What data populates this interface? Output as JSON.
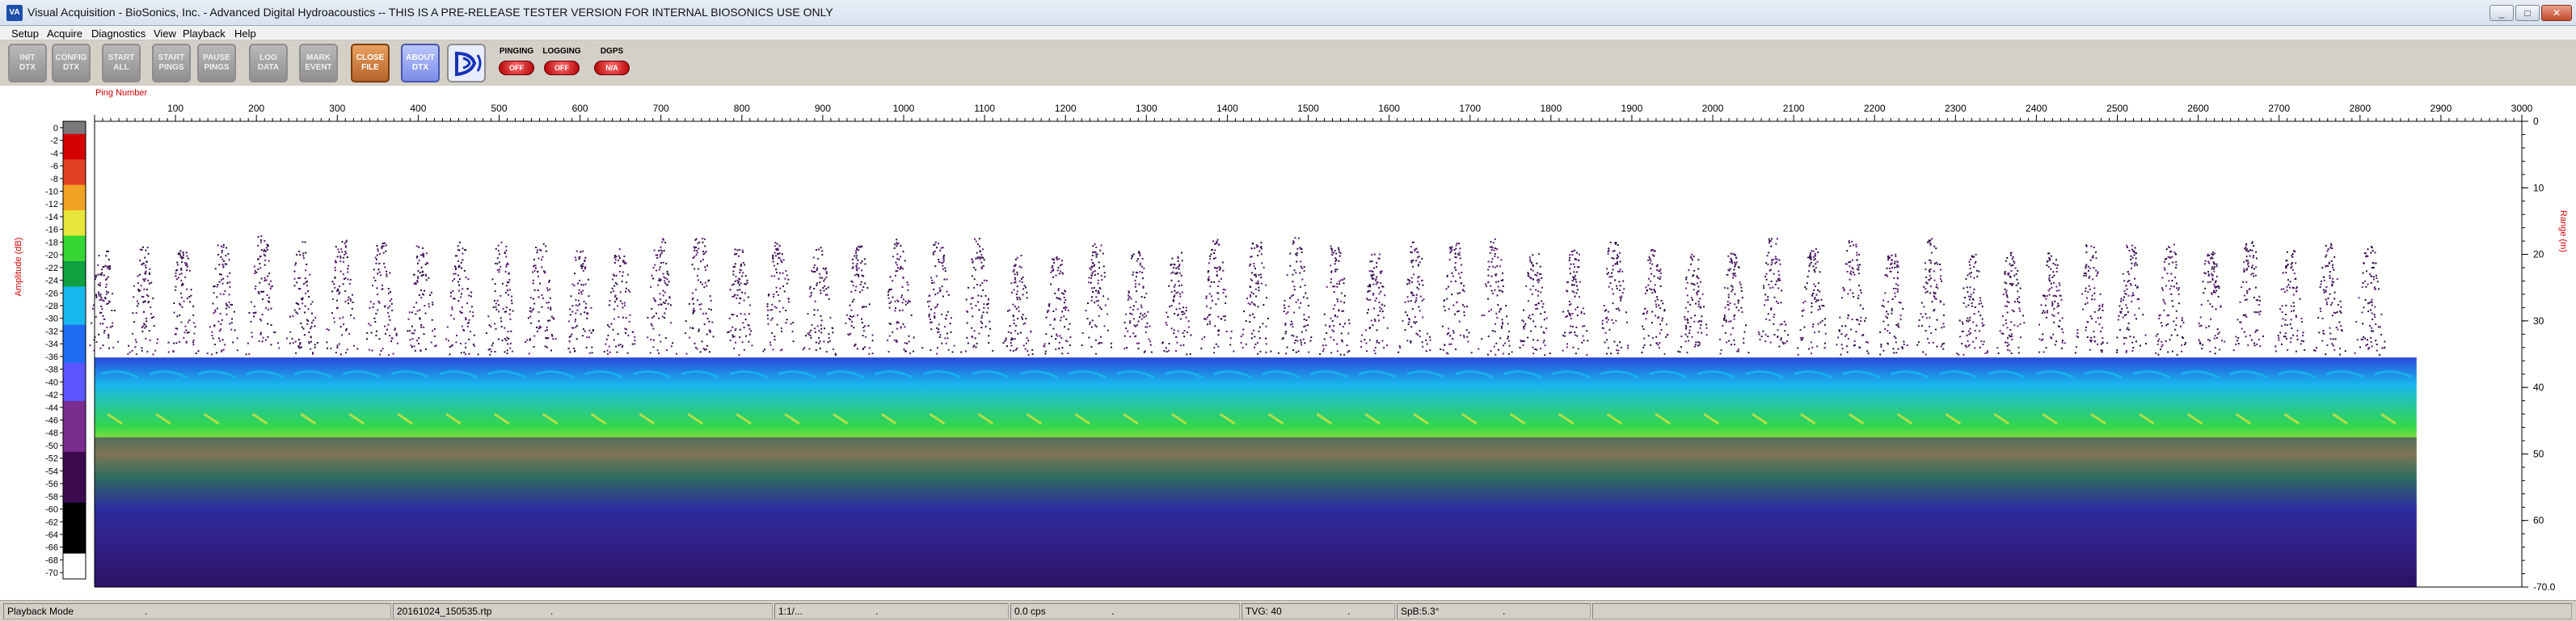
{
  "window": {
    "icon_text": "VA",
    "title": "Visual Acquisition  - BioSonics, Inc.  - Advanced Digital Hydroacoustics  -- THIS IS A PRE-RELEASE TESTER VERSION FOR INTERNAL BIOSONICS USE ONLY",
    "min": "_",
    "max": "□",
    "close": "✕"
  },
  "menu": [
    "Setup",
    "Acquire",
    "Diagnostics",
    "View",
    "Playback",
    "Help"
  ],
  "toolbar": {
    "buttons": [
      {
        "label": "INIT\nDTX",
        "style": "gray"
      },
      {
        "label": "CONFIG\nDTX",
        "style": "gray"
      },
      {
        "label": "START\nALL",
        "style": "gray"
      },
      {
        "label": "START\nPINGS",
        "style": "gray"
      },
      {
        "label": "PAUSE\nPINGS",
        "style": "gray"
      },
      {
        "label": "LOG\nDATA",
        "style": "gray"
      },
      {
        "label": "MARK\nEVENT",
        "style": "gray"
      },
      {
        "label": "CLOSE\nFILE",
        "style": "orange"
      },
      {
        "label": "ABOUT\nDTX",
        "style": "blue"
      }
    ],
    "logo_icon": "biosonics-logo-icon",
    "indicators": [
      {
        "label": "PINGING",
        "state": "OFF"
      },
      {
        "label": "LOGGING",
        "state": "OFF"
      },
      {
        "label": "DGPS",
        "state": "N/A"
      }
    ]
  },
  "colors": {
    "echo_weak": "#5b1a73",
    "echo_blue": "#2a49d8",
    "echo_green": "#33d64a",
    "echo_yellow": "#e8e43a",
    "echo_red": "#e22a1a",
    "axis_label_red": "#d40000"
  },
  "echogram": {
    "x_axis_label": "Ping Number",
    "x_ticks": [
      100,
      200,
      300,
      400,
      500,
      600,
      700,
      800,
      900,
      1000,
      1100,
      1200,
      1300,
      1400,
      1500,
      1600,
      1700,
      1800,
      1900,
      2000,
      2100,
      2200,
      2300,
      2400,
      2500,
      2600,
      2700,
      2800,
      2900,
      3000
    ],
    "x_range": [
      0,
      3000
    ],
    "pings_recorded": 2870,
    "range_label": "Range (m)",
    "range_ticks": [
      "0",
      "10",
      "20",
      "30",
      "40",
      "50",
      "60",
      "-70.0"
    ],
    "range_max": 70,
    "amplitude_label": "Amplitude (dB)",
    "amplitude_ticks": [
      0,
      -2,
      -4,
      -6,
      -8,
      -10,
      -12,
      -14,
      -16,
      -18,
      -20,
      -22,
      -24,
      -26,
      -28,
      -30,
      -32,
      -34,
      -36,
      -38,
      -40,
      -42,
      -44,
      -46,
      -48,
      -50,
      -52,
      -54,
      -56,
      -58,
      -60,
      -62,
      -64,
      -66,
      -68,
      -70
    ],
    "amplitude_range": [
      0,
      -70
    ],
    "color_scale": [
      "#ffffff",
      "#000000",
      "#3b0a4f",
      "#7a2d8f",
      "#5a55ff",
      "#1f6cf0",
      "#18b8ee",
      "#10a040",
      "#36d633",
      "#e6e63a",
      "#f2a223",
      "#e04020",
      "#d40000",
      "#7a7a7a"
    ]
  },
  "status": [
    {
      "text": "Playback Mode",
      "dot": "."
    },
    {
      "text": "20161024_150535.rtp",
      "dot": "."
    },
    {
      "text": "1:1/...",
      "dot": "."
    },
    {
      "text": "0.0 cps",
      "dot": "."
    },
    {
      "text": "TVG: 40",
      "dot": "."
    },
    {
      "text": "SpB:5.3°",
      "dot": "."
    },
    {
      "text": "",
      "dot": ""
    }
  ]
}
